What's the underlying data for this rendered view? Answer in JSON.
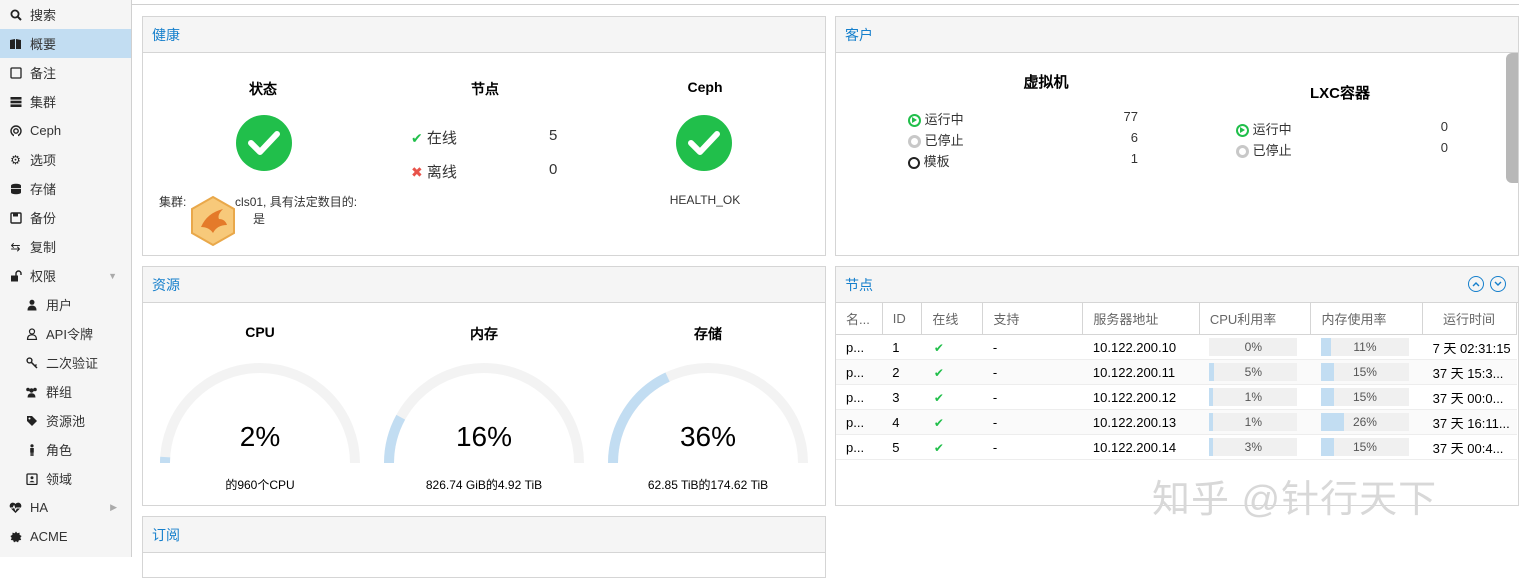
{
  "sidebar": {
    "items": [
      {
        "label": "搜索"
      },
      {
        "label": "概要"
      },
      {
        "label": "备注"
      },
      {
        "label": "集群"
      },
      {
        "label": "Ceph"
      },
      {
        "label": "选项"
      },
      {
        "label": "存储"
      },
      {
        "label": "备份"
      },
      {
        "label": "复制"
      },
      {
        "label": "权限"
      },
      {
        "label": "用户"
      },
      {
        "label": "API令牌"
      },
      {
        "label": "二次验证"
      },
      {
        "label": "群组"
      },
      {
        "label": "资源池"
      },
      {
        "label": "角色"
      },
      {
        "label": "领域"
      },
      {
        "label": "HA"
      },
      {
        "label": "ACME"
      }
    ]
  },
  "health": {
    "title": "健康",
    "status_label": "状态",
    "cluster_prefix": "集群:",
    "cluster_suffix": "cls01, 具有法定数目的:",
    "quorate": "是",
    "nodes_label": "节点",
    "online_label": "在线",
    "online_count": "5",
    "offline_label": "离线",
    "offline_count": "0",
    "ceph_label": "Ceph",
    "ceph_status": "HEALTH_OK"
  },
  "guests": {
    "title": "客户",
    "vm_title": "虚拟机",
    "vm_running_label": "运行中",
    "vm_running": "77",
    "vm_stopped_label": "已停止",
    "vm_stopped": "6",
    "vm_template_label": "模板",
    "vm_template": "1",
    "lxc_title": "LXC容器",
    "lxc_running_label": "运行中",
    "lxc_running": "0",
    "lxc_stopped_label": "已停止",
    "lxc_stopped": "0"
  },
  "resources": {
    "title": "资源",
    "cpu_label": "CPU",
    "cpu_value": "2%",
    "cpu_fraction": 0.02,
    "cpu_sub": "的960个CPU",
    "mem_label": "内存",
    "mem_value": "16%",
    "mem_fraction": 0.16,
    "mem_sub": "826.74 GiB的4.92 TiB",
    "storage_label": "存储",
    "storage_value": "36%",
    "storage_fraction": 0.36,
    "storage_sub": "62.85 TiB的174.62 TiB"
  },
  "nodes_panel": {
    "title": "节点",
    "columns": [
      "名...",
      "ID",
      "在线",
      "支持",
      "服务器地址",
      "CPU利用率",
      "内存使用率",
      "运行时间"
    ],
    "rows": [
      {
        "name": "p...",
        "id": "1",
        "support": "-",
        "address": "10.122.200.10",
        "cpu": "0%",
        "cpu_frac": 0.0,
        "mem": "11%",
        "mem_frac": 0.11,
        "uptime": "7 天 02:31:15"
      },
      {
        "name": "p...",
        "id": "2",
        "support": "-",
        "address": "10.122.200.11",
        "cpu": "5%",
        "cpu_frac": 0.05,
        "mem": "15%",
        "mem_frac": 0.15,
        "uptime": "37 天 15:3..."
      },
      {
        "name": "p...",
        "id": "3",
        "support": "-",
        "address": "10.122.200.12",
        "cpu": "1%",
        "cpu_frac": 0.01,
        "mem": "15%",
        "mem_frac": 0.15,
        "uptime": "37 天 00:0..."
      },
      {
        "name": "p...",
        "id": "4",
        "support": "-",
        "address": "10.122.200.13",
        "cpu": "1%",
        "cpu_frac": 0.01,
        "mem": "26%",
        "mem_frac": 0.26,
        "uptime": "37 天 16:11..."
      },
      {
        "name": "p...",
        "id": "5",
        "support": "-",
        "address": "10.122.200.14",
        "cpu": "3%",
        "cpu_frac": 0.03,
        "mem": "15%",
        "mem_frac": 0.15,
        "uptime": "37 天 00:4..."
      }
    ]
  },
  "subscription": {
    "title": "订阅"
  },
  "watermark": "知乎 @针行天下",
  "colors": {
    "accent": "#157fcc",
    "ok_green": "#21bf4b",
    "error_red": "#e8534a",
    "gauge_fill": "#c2ddf2",
    "gauge_track": "#f3f3f3"
  }
}
